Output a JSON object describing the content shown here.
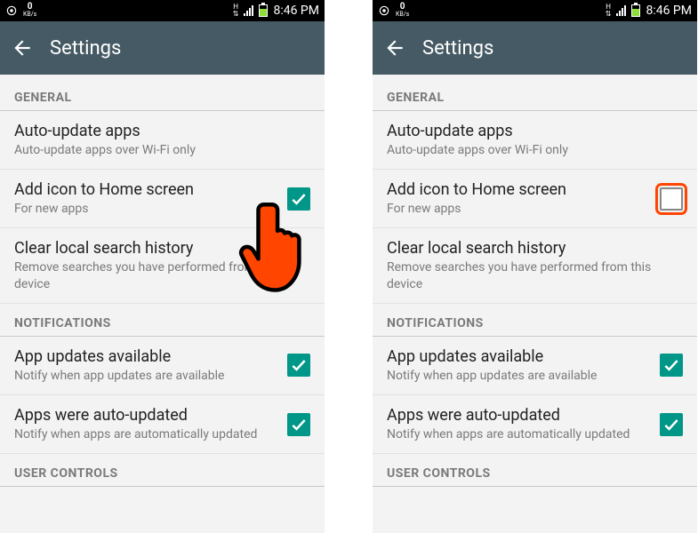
{
  "status": {
    "speed_value": "0",
    "speed_unit": "KB/s",
    "net_label": "H",
    "time": "8:46 PM"
  },
  "appbar": {
    "title": "Settings"
  },
  "sections": {
    "general": "GENERAL",
    "notifications": "NOTIFICATIONS",
    "user_controls": "USER CONTROLS"
  },
  "rows": {
    "auto_update": {
      "title": "Auto-update apps",
      "sub": "Auto-update apps over Wi-Fi only"
    },
    "add_icon": {
      "title": "Add icon to Home screen",
      "sub": "For new apps"
    },
    "clear_history": {
      "title": "Clear local search history",
      "sub": "Remove searches you have performed from this device"
    },
    "updates_avail": {
      "title": "App updates available",
      "sub": "Notify when app updates are available"
    },
    "auto_updated": {
      "title": "Apps were auto-updated",
      "sub": "Notify when apps are automatically updated"
    }
  },
  "screens": {
    "left": {
      "add_icon_checked": true,
      "show_hand": true,
      "highlight_unchecked": false
    },
    "right": {
      "add_icon_checked": false,
      "show_hand": false,
      "highlight_unchecked": true
    }
  }
}
